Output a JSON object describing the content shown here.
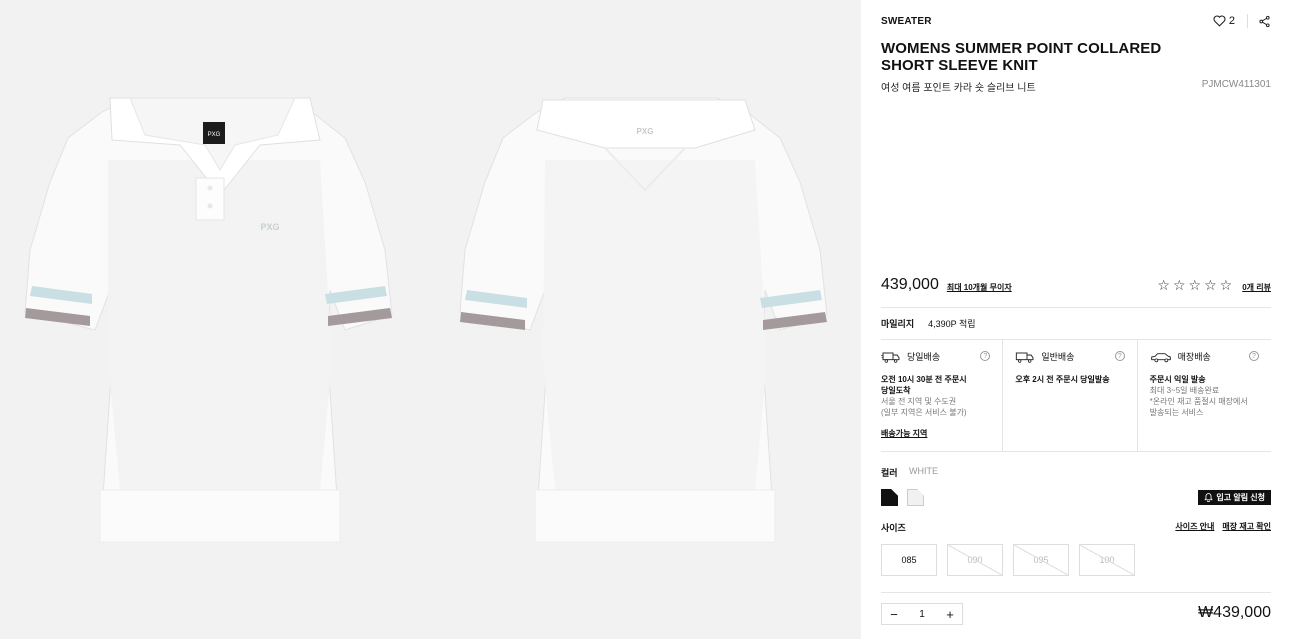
{
  "gallery": {
    "images": [
      {
        "alt": "front view",
        "color": "#ffffff"
      },
      {
        "alt": "back view",
        "color": "#ffffff"
      }
    ],
    "stripe_colors": {
      "light": "#c9dfe3",
      "dark": "#a49a9b"
    }
  },
  "product": {
    "category": "SWEATER",
    "likes": "2",
    "title": "WOMENS SUMMER POINT COLLARED SHORT SLEEVE KNIT",
    "subtitle": "여성 여름 포인트 카라 숏 슬리브 니트",
    "code": "PJMCW411301",
    "price": "439,000",
    "installment": "최대 10개월 무이자",
    "rating": 0,
    "reviews": "0개 리뷰"
  },
  "mileage": {
    "label": "마일리지",
    "value": "4,390P 적립"
  },
  "delivery": [
    {
      "icon": "same-day-truck-icon",
      "name": "당일배송",
      "title_lines": [
        "오전 10시 30분 전 주문시",
        "당일도착"
      ],
      "notes": [
        "서울 전 지역 및 수도권",
        "(일부 지역은 서비스 불가)"
      ],
      "link": "배송가능 지역"
    },
    {
      "icon": "truck-icon",
      "name": "일반배송",
      "title_lines": [
        "오후 2시 전 주문시 당일발송"
      ],
      "notes": [],
      "link": ""
    },
    {
      "icon": "car-icon",
      "name": "매장배송",
      "title_lines": [
        "주문시 익일 발송"
      ],
      "notes": [
        "최대 3~5일 배송완료",
        "*온라인 재고 품절시 매장에서",
        "발송되는 서비스"
      ],
      "link": ""
    }
  ],
  "color": {
    "label": "컬러",
    "value": "WHITE",
    "swatches": [
      "#111111",
      "#f1f1f1"
    ]
  },
  "restock_label": "입고 알림 신청",
  "size": {
    "label": "사이즈",
    "guide": "사이즈 안내",
    "store_stock": "매장 재고 확인",
    "options": [
      {
        "label": "085",
        "sold_out": false
      },
      {
        "label": "090",
        "sold_out": true
      },
      {
        "label": "095",
        "sold_out": true
      },
      {
        "label": "100",
        "sold_out": true
      }
    ]
  },
  "quantity": {
    "minus": "−",
    "value": "1",
    "plus": "+"
  },
  "total": "₩439,000",
  "help_glyph": "?"
}
